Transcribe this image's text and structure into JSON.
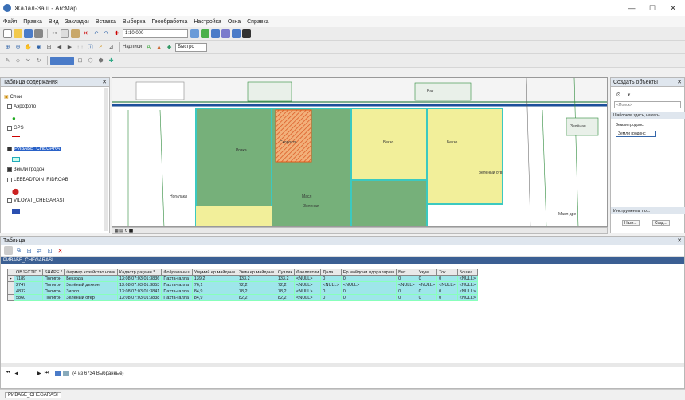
{
  "titlebar": {
    "title": "Жалал-Заш - ArcMap",
    "min": "—",
    "max": "☐",
    "close": "✕"
  },
  "menubar": [
    "Файл",
    "Правка",
    "Вид",
    "Закладки",
    "Вставка",
    "Выборка",
    "Геообработка",
    "Настройка",
    "Окна",
    "Справка"
  ],
  "toolbar": {
    "scale": "1:10 000",
    "georef_label": "Надписи",
    "fast_label": "Быстро"
  },
  "toc": {
    "title": "Таблица содержания",
    "layers_root": "Слои",
    "items": [
      "Аэрофото",
      "GPS",
      "РИВАБЕ_CHEGARA",
      "Земли гродон",
      "LEBEADTOIN_RIDROAB",
      "VILOYAT_CHEGARASI"
    ]
  },
  "catalog": {
    "title": "Создать объекты",
    "search_placeholder": "<Поиск>",
    "hint": "Шаблонов здесь, нажать",
    "group": "Земли гродонс",
    "selected": "Земли гродонс",
    "tools_label": "Инструменты по...",
    "bottom_btns": [
      "Назн...",
      "Созд..."
    ]
  },
  "map_labels": {
    "road": "Ровка",
    "l1": "Скорость",
    "l2": "Бекзо",
    "l3": "Зелёный отв",
    "l4": "Масл",
    "l5": "Зеленая",
    "l6": "Ногилакл",
    "l7": "Зелёная",
    "l8": "Бак",
    "l9": "Масл дре"
  },
  "attr_table": {
    "pane_title": "Таблица",
    "layer_name": "РИВАБЕ_CHEGARASI",
    "columns": [
      "OBJECTID *",
      "SHAPE *",
      "Фермер хозяйство номи",
      "Кадастр рақами *",
      "Фойдаланиш",
      "Умумий ер майдони",
      "Экин ер майдони",
      "Сувлик",
      "Фаоллятли",
      "Дала",
      "Ер майдони идоралариш",
      "Бит",
      "Узум",
      "Ток",
      "Бошка"
    ],
    "rows": [
      [
        "7189",
        "Полигон",
        "Бекзода",
        "13:08:07:03:01:3836",
        "Пахта-ғалла",
        "139,2",
        "133,2",
        "133,2",
        "<NULL>",
        "0",
        "0",
        "0",
        "0",
        "0",
        "<NULL>"
      ],
      [
        "2747",
        "Полигон",
        "Зелёный дехкон",
        "13:08:07:03:01:3853",
        "Пахта-ғалла",
        "76,1",
        "72,2",
        "72,2",
        "<NULL>",
        "<NULL>",
        "<NULL>",
        "<NULL>",
        "<NULL>",
        "<NULL>",
        "<NULL>"
      ],
      [
        "4832",
        "Полигон",
        "Зилол",
        "13:08:07:03:01:3841",
        "Пахта-ғалла",
        "84,9",
        "78,2",
        "78,2",
        "<NULL>",
        "0",
        "0",
        "0",
        "0",
        "0",
        "<NULL>"
      ],
      [
        "5860",
        "Полигон",
        "Зелёный отер",
        "13:08:07:03:01:3838",
        "Пахта-ғалла",
        "84,9",
        "82,2",
        "82,2",
        "<NULL>",
        "0",
        "0",
        "0",
        "0",
        "0",
        "<NULL>"
      ]
    ],
    "nav_status": "(4 из 6734 Выбранные)",
    "bottom_tab": "РИВАБЕ_CHEGARASI"
  }
}
